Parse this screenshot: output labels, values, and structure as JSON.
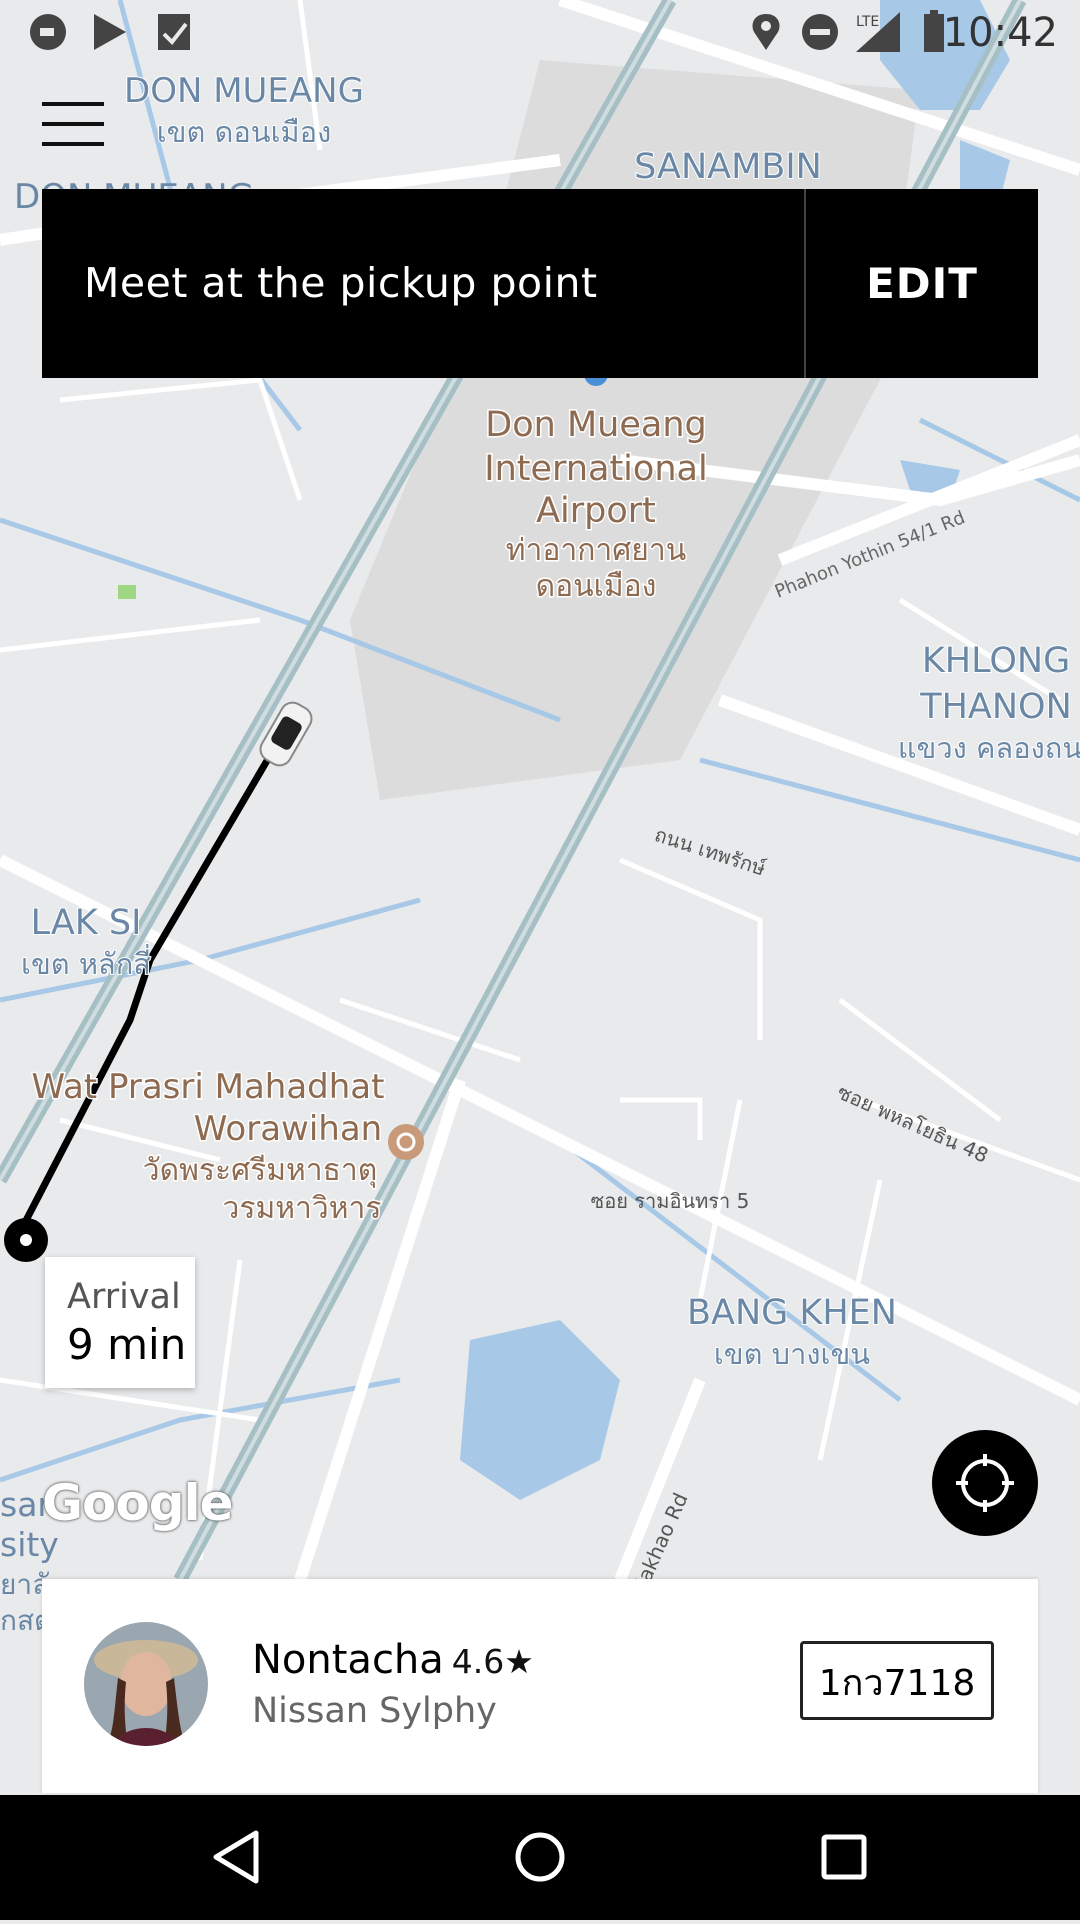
{
  "status_bar": {
    "time": "10:42",
    "left_icons": [
      "app-icon",
      "play-store-icon",
      "task-icon"
    ],
    "right_icons": [
      "location-icon",
      "do-not-disturb-icon",
      "lte-signal-icon",
      "battery-icon"
    ],
    "network": "LTE"
  },
  "banner": {
    "message": "Meet at the pickup point",
    "edit_label": "EDIT"
  },
  "map": {
    "labels": {
      "don_mueang": "DON MUEANG",
      "don_mueang_thai": "เขต ดอนเมือง",
      "don_mueang_partial": "DON MUEANG",
      "sanambin": "SANAMBIN",
      "airport_line1": "Don Mueang",
      "airport_line2": "International",
      "airport_line3": "Airport",
      "airport_thai1": "ท่าอากาศยาน",
      "airport_thai2": "ดอนเมือง",
      "phahon_road": "Phahon Yothin 54/1 Rd",
      "khlong_thanon1": "KHLONG",
      "khlong_thanon2": "THANON",
      "khlong_thanon_thai": "แขวง คลองถน",
      "thepharak": "ถนน เทพรักษ์",
      "lak_si": "LAK SI",
      "lak_si_thai": "เขต หลักสี่",
      "wat_line1": "Wat Prasri Mahadhat",
      "wat_line2": "Worawihan",
      "wat_thai1": "วัดพระศรีมหาธาตุ",
      "wat_thai2": "วรมหาวิหาร",
      "soi_phahon48": "ซอย พหลโยธิน 48",
      "soi_ram5": "ซอย รามอินทรา 5",
      "bang_khen": "BANG KHEN",
      "bang_khen_thai": "เขต บางเขน",
      "plakhao": "at Plakhao Rd",
      "edge_sar": "sar",
      "edge_sity": "sity",
      "edge_thai1": "ยาลั",
      "edge_thai2": "กสต"
    },
    "google_logo": "Google"
  },
  "arrival": {
    "label": "Arrival",
    "time": "9 min"
  },
  "driver": {
    "name": "Nontacha",
    "rating": "4.6★",
    "car": "Nissan Sylphy",
    "plate": "1กว7118"
  },
  "colors": {
    "banner_bg": "#000000",
    "map_bg": "#e8eaec",
    "water": "#a8c8e8",
    "route": "#000000"
  }
}
